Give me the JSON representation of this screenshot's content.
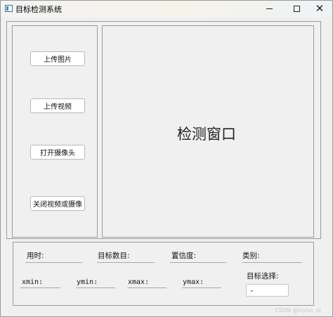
{
  "window": {
    "title": "目标检测系统",
    "icon": "app-window-icon",
    "controls": {
      "minimize": "minimize-icon",
      "maximize": "maximize-icon",
      "close": "✕"
    }
  },
  "sidebar": {
    "buttons": [
      {
        "label": "上传图片"
      },
      {
        "label": "上传视频"
      },
      {
        "label": "打开摄像头"
      },
      {
        "label": "关闭视频或摄像"
      }
    ]
  },
  "display": {
    "title": "检测窗口"
  },
  "stats": {
    "time_label": "用时:",
    "target_count_label": "目标数目:",
    "confidence_label": "置信度:",
    "category_label": "类别:",
    "xmin_label": "xmin:",
    "ymin_label": "ymin:",
    "xmax_label": "xmax:",
    "ymax_label": "ymax:",
    "target_select_label": "目标选择:",
    "target_select_value": ""
  },
  "watermark": "CSDN @lzybo_ai"
}
